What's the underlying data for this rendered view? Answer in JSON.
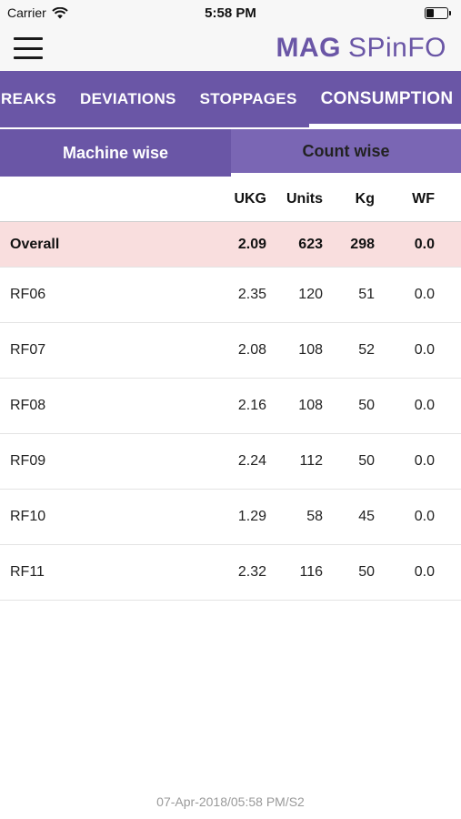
{
  "status_bar": {
    "carrier": "Carrier",
    "time": "5:58 PM",
    "battery_level": 0.35
  },
  "header": {
    "logo_bold": "MAG",
    "logo_rest": "SPinFO"
  },
  "tabs": [
    {
      "label": "REAKS"
    },
    {
      "label": "DEVIATIONS"
    },
    {
      "label": "STOPPAGES"
    },
    {
      "label": "CONSUMPTION",
      "active": true
    }
  ],
  "sub_tabs": [
    {
      "label": "Machine wise",
      "active": true
    },
    {
      "label": "Count wise",
      "active": false
    }
  ],
  "table": {
    "columns": [
      "UKG",
      "Units",
      "Kg",
      "WF"
    ],
    "overall": {
      "name": "Overall",
      "ukg": "2.09",
      "units": "623",
      "kg": "298",
      "wf": "0.0"
    },
    "rows": [
      {
        "name": "RF06",
        "ukg": "2.35",
        "units": "120",
        "kg": "51",
        "wf": "0.0"
      },
      {
        "name": "RF07",
        "ukg": "2.08",
        "units": "108",
        "kg": "52",
        "wf": "0.0"
      },
      {
        "name": "RF08",
        "ukg": "2.16",
        "units": "108",
        "kg": "50",
        "wf": "0.0"
      },
      {
        "name": "RF09",
        "ukg": "2.24",
        "units": "112",
        "kg": "50",
        "wf": "0.0"
      },
      {
        "name": "RF10",
        "ukg": "1.29",
        "units": "58",
        "kg": "45",
        "wf": "0.0"
      },
      {
        "name": "RF11",
        "ukg": "2.32",
        "units": "116",
        "kg": "50",
        "wf": "0.0"
      }
    ]
  },
  "footer": {
    "timestamp": "07-Apr-2018/05:58 PM/S2"
  },
  "colors": {
    "accent": "#6a56a6",
    "overall_row": "#f9dede"
  }
}
